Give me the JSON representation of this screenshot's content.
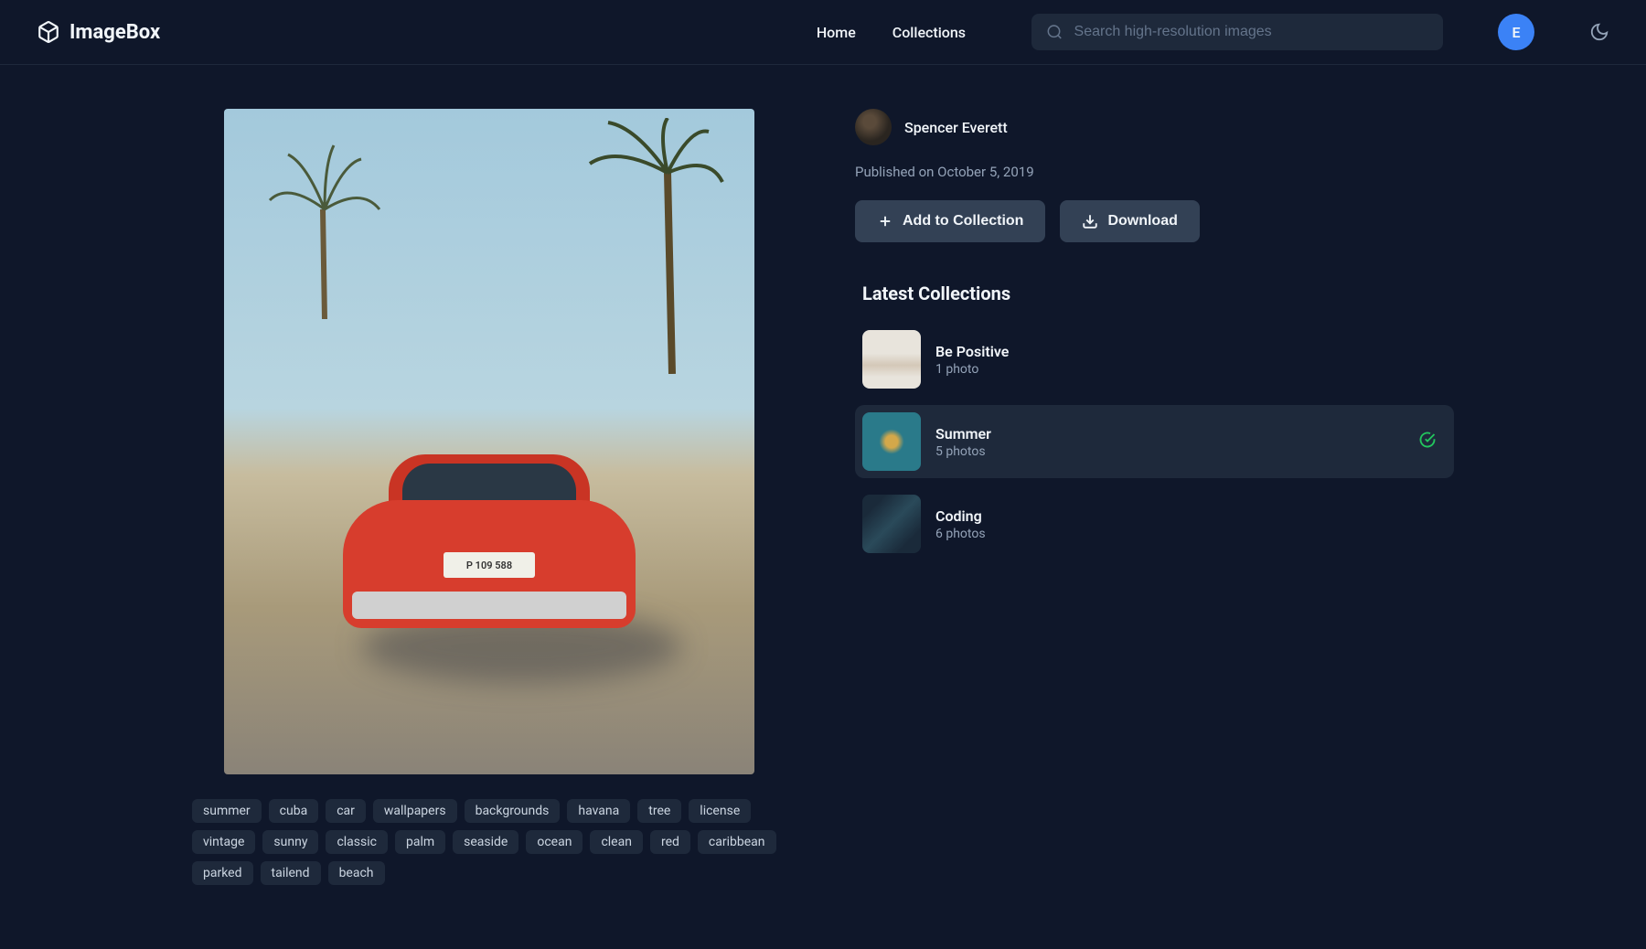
{
  "brand": "ImageBox",
  "nav": {
    "home": "Home",
    "collections": "Collections"
  },
  "search": {
    "placeholder": "Search high-resolution images"
  },
  "user": {
    "initial": "E"
  },
  "image": {
    "license_plate": "P 109 588"
  },
  "author": {
    "name": "Spencer Everett"
  },
  "published": "Published on October 5, 2019",
  "actions": {
    "add_to_collection": "Add to Collection",
    "download": "Download"
  },
  "sections": {
    "latest_collections": "Latest Collections"
  },
  "collections": [
    {
      "name": "Be Positive",
      "count": "1 photo"
    },
    {
      "name": "Summer",
      "count": "5 photos"
    },
    {
      "name": "Coding",
      "count": "6 photos"
    }
  ],
  "tags": [
    "summer",
    "cuba",
    "car",
    "wallpapers",
    "backgrounds",
    "havana",
    "tree",
    "license",
    "vintage",
    "sunny",
    "classic",
    "palm",
    "seaside",
    "ocean",
    "clean",
    "red",
    "caribbean",
    "parked",
    "tailend",
    "beach"
  ]
}
